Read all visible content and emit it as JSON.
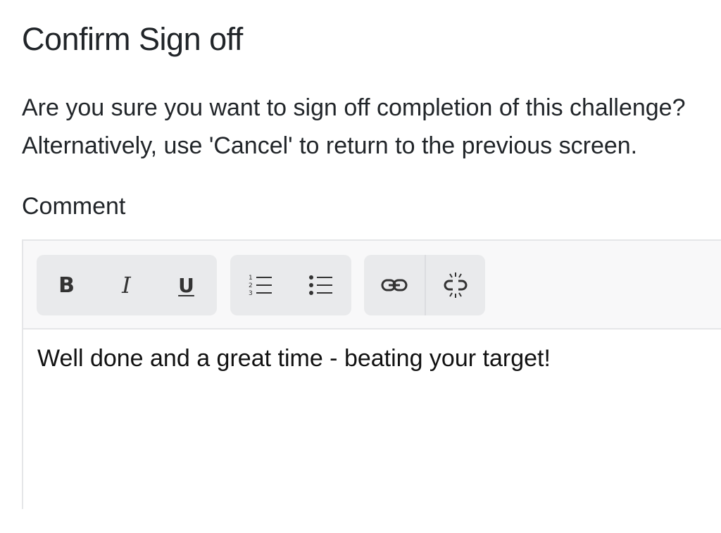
{
  "dialog": {
    "title": "Confirm Sign off",
    "message_line1": "Are you sure you want to sign off completion of this challenge?",
    "message_line2": "Alternatively, use 'Cancel' to return to the previous screen."
  },
  "comment": {
    "label": "Comment",
    "value": "Well done and a great time - beating your target!"
  },
  "toolbar": {
    "bold": "B",
    "italic": "I",
    "underline": "U",
    "icons": [
      "bold-icon",
      "italic-icon",
      "underline-icon",
      "ordered-list-icon",
      "bullet-list-icon",
      "link-icon",
      "unlink-icon"
    ]
  }
}
